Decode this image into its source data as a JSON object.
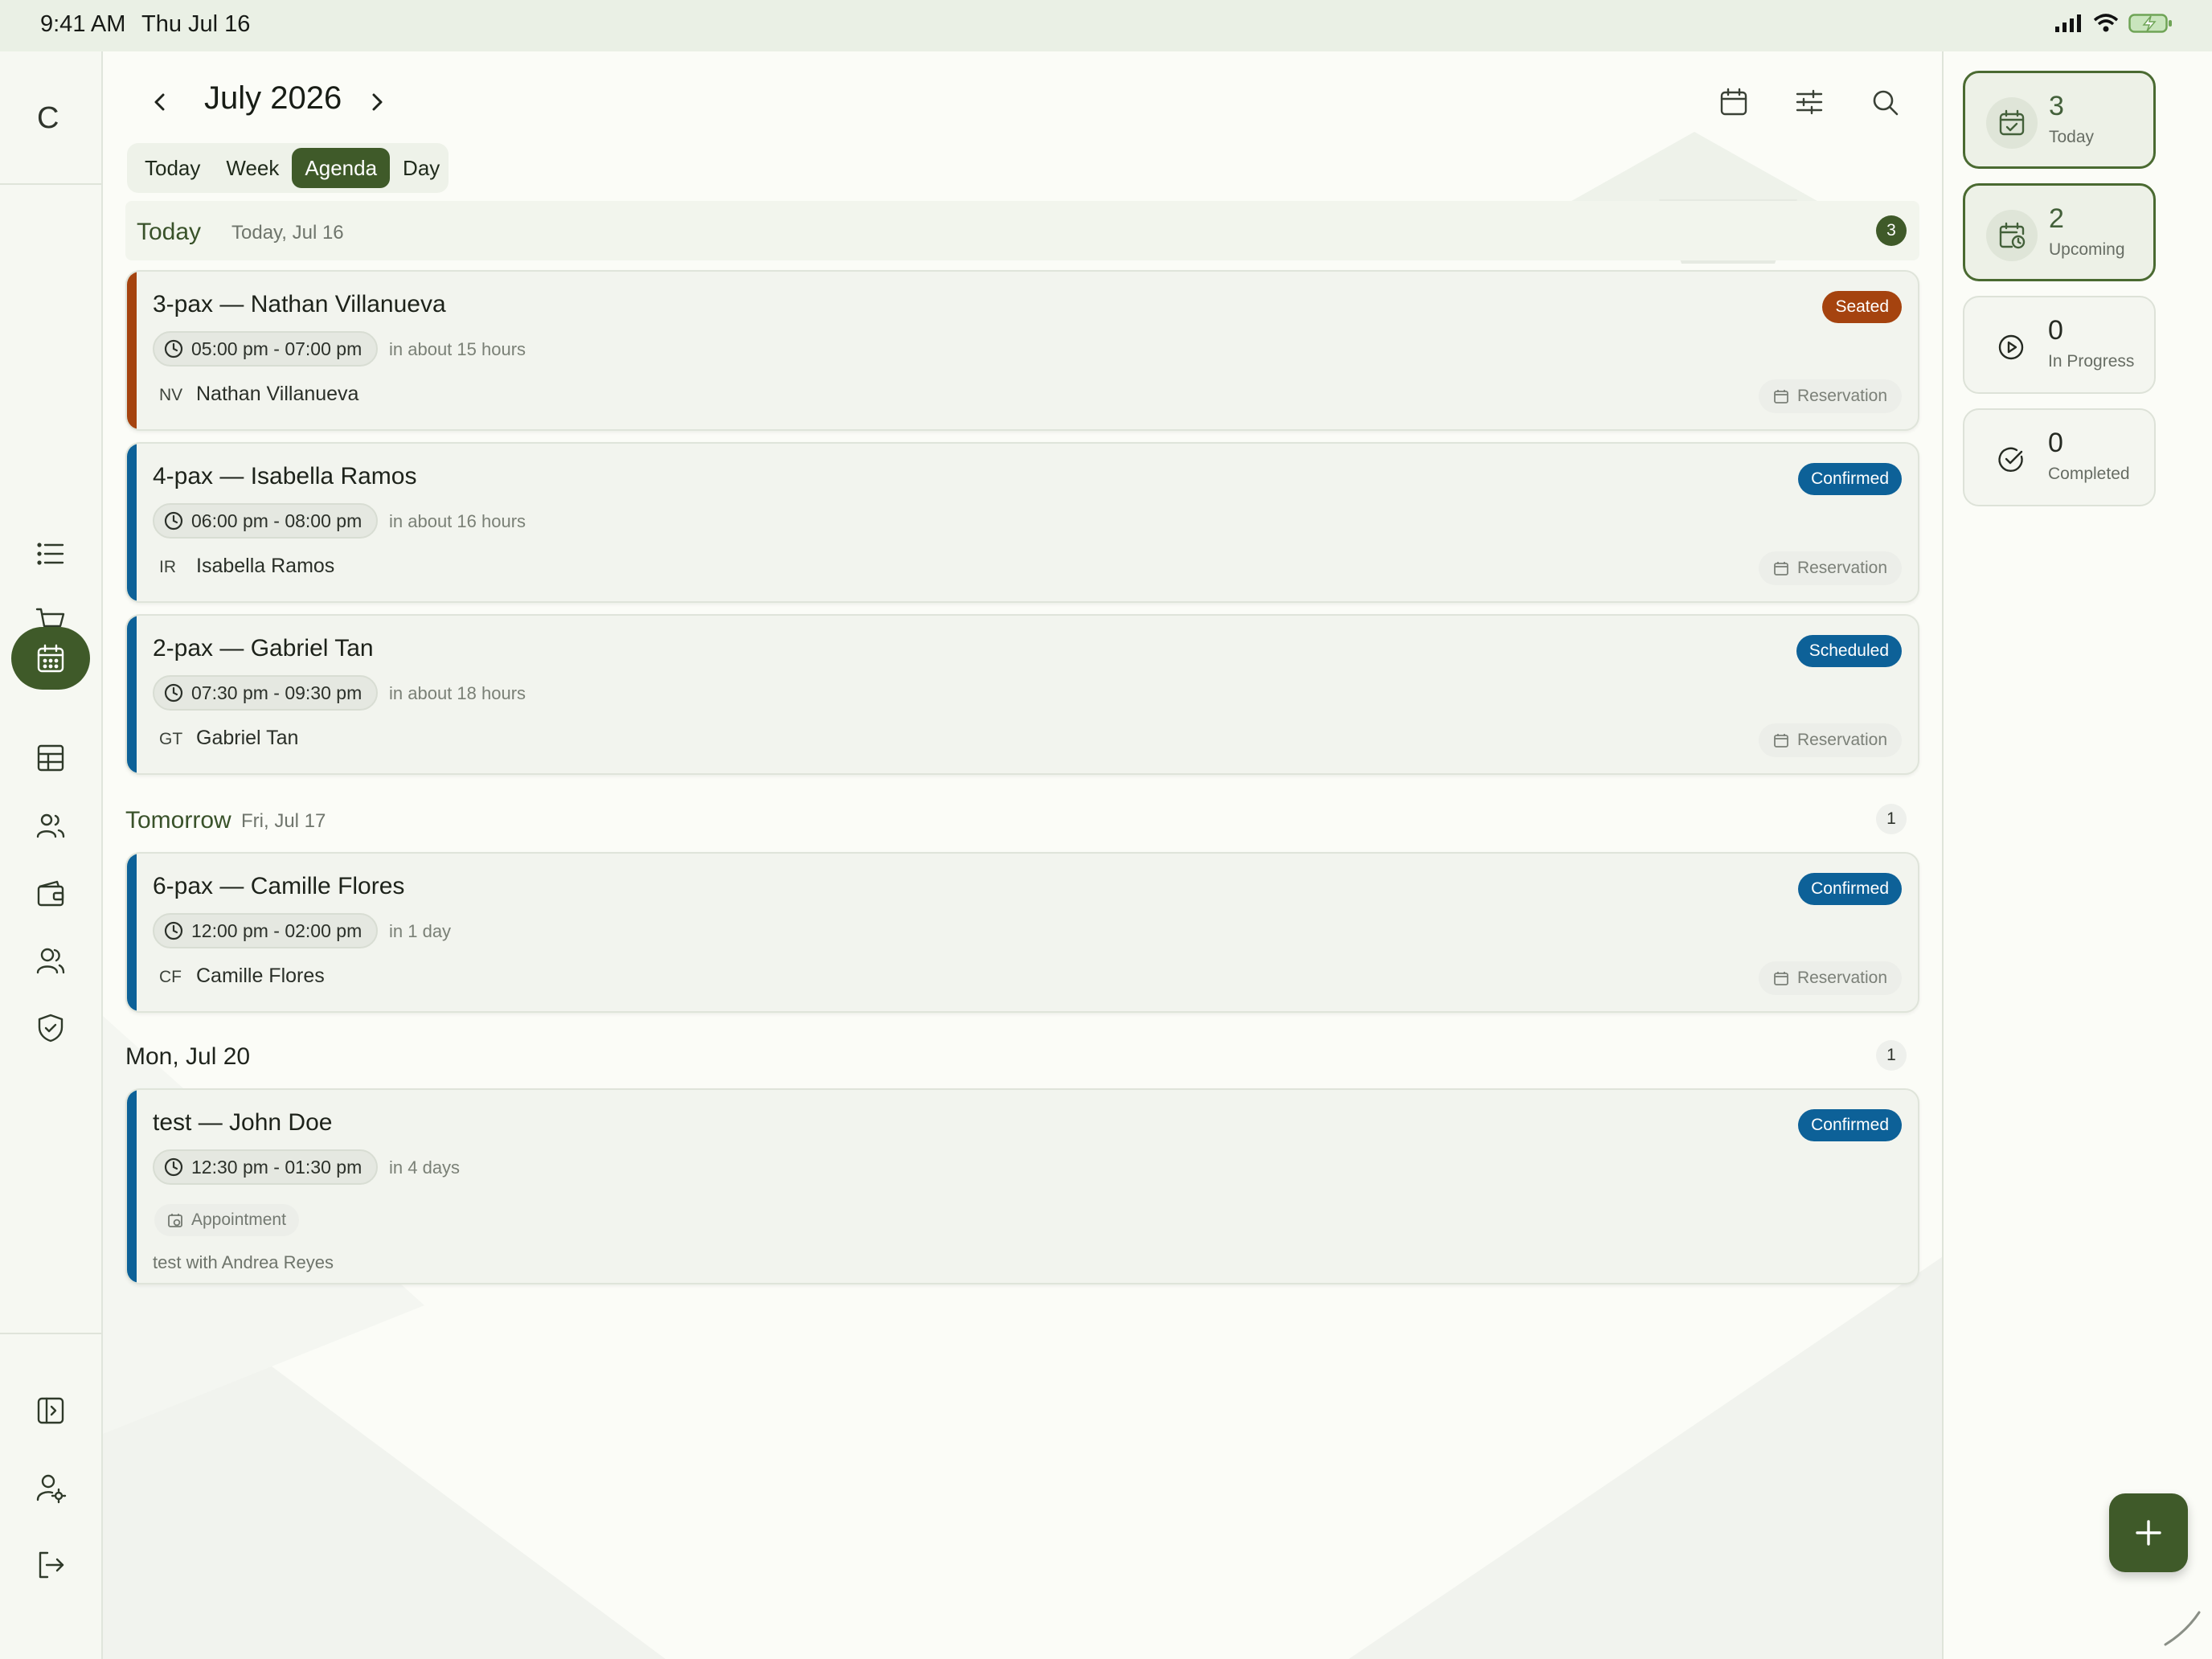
{
  "status_bar": {
    "time": "9:41 AM",
    "date": "Thu Jul 16"
  },
  "sidebar": {
    "brand": "C",
    "items": [
      {
        "icon": "list-icon"
      },
      {
        "icon": "cart-icon"
      },
      {
        "icon": "calendar-icon",
        "active": true
      },
      {
        "icon": "table-icon"
      },
      {
        "icon": "users-icon"
      },
      {
        "icon": "wallet-icon"
      },
      {
        "icon": "staff-icon"
      },
      {
        "icon": "shield-check-icon"
      }
    ],
    "bottom": [
      {
        "icon": "expand-panel-icon"
      },
      {
        "icon": "user-settings-icon"
      },
      {
        "icon": "logout-icon"
      }
    ]
  },
  "header": {
    "month_title": "July 2026",
    "icons": [
      "calendar-icon",
      "sliders-icon",
      "search-icon"
    ]
  },
  "view_tabs": [
    "Today",
    "Week",
    "Agenda",
    "Day"
  ],
  "active_view": "Agenda",
  "sections": [
    {
      "title": "Today",
      "subtitle": "Today, Jul 16",
      "count": "3",
      "events": [
        {
          "title": "3-pax — Nathan Villanueva",
          "status": "Seated",
          "status_color": "#a5430f",
          "accent": "#a5430f",
          "time": "05:00 pm - 07:00 pm",
          "relative": "in about 15 hours",
          "initials": "NV",
          "customer": "Nathan Villanueva",
          "type": "Reservation"
        },
        {
          "title": "4-pax — Isabella Ramos",
          "status": "Confirmed",
          "status_color": "#0d6198",
          "accent": "#0d6198",
          "time": "06:00 pm - 08:00 pm",
          "relative": "in about 16 hours",
          "initials": "IR",
          "customer": "Isabella Ramos",
          "type": "Reservation"
        },
        {
          "title": "2-pax — Gabriel Tan",
          "status": "Scheduled",
          "status_color": "#0d6198",
          "accent": "#0d6198",
          "time": "07:30 pm - 09:30 pm",
          "relative": "in about 18 hours",
          "initials": "GT",
          "customer": "Gabriel Tan",
          "type": "Reservation"
        }
      ]
    },
    {
      "title": "Tomorrow",
      "subtitle": "Fri, Jul 17",
      "count": "1",
      "events": [
        {
          "title": "6-pax — Camille Flores",
          "status": "Confirmed",
          "status_color": "#0d6198",
          "accent": "#0d6198",
          "time": "12:00 pm - 02:00 pm",
          "relative": "in 1 day",
          "initials": "CF",
          "customer": "Camille Flores",
          "type": "Reservation"
        }
      ]
    },
    {
      "title": "Mon, Jul 20",
      "subtitle": "",
      "count": "1",
      "events": [
        {
          "title": "test — John Doe",
          "status": "Confirmed",
          "status_color": "#0d6198",
          "accent": "#0d6198",
          "time": "12:30 pm - 01:30 pm",
          "relative": "in 4 days",
          "appointment_label": "Appointment",
          "note": "test with Andrea Reyes"
        }
      ]
    }
  ],
  "summary": [
    {
      "count": "3",
      "label": "Today",
      "icon": "calendar-check-icon"
    },
    {
      "count": "2",
      "label": "Upcoming",
      "icon": "calendar-clock-icon"
    },
    {
      "count": "0",
      "label": "In Progress",
      "icon": "play-circle-icon"
    },
    {
      "count": "0",
      "label": "Completed",
      "icon": "check-circle-icon"
    }
  ],
  "fab": {
    "icon": "plus-icon"
  }
}
